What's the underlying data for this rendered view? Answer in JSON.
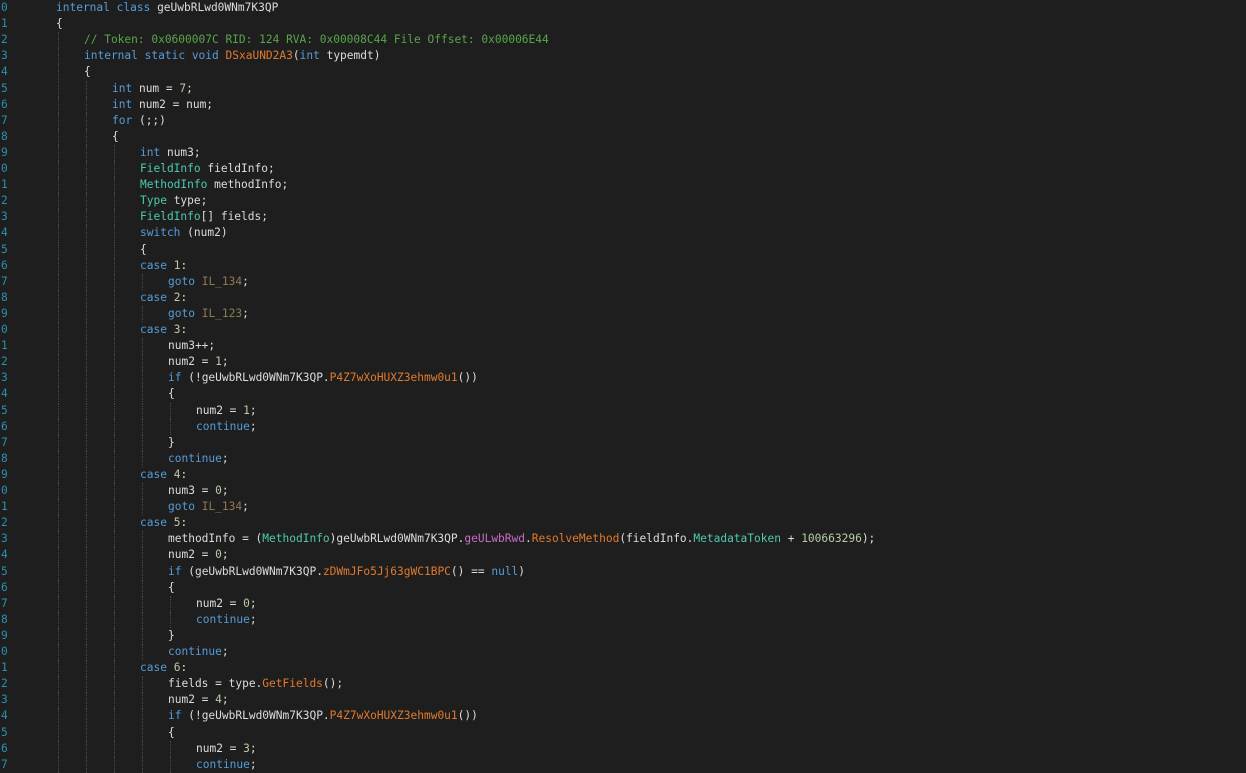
{
  "editor": {
    "theme_colors": {
      "background": "#1e1e1e",
      "line_number": "#2b91af",
      "keyword": "#569cd6",
      "type": "#4ec9b0",
      "comment": "#57a64a",
      "label": "#8c7b51",
      "method": "#e07a2e",
      "field": "#c76ac4",
      "number": "#b5cea8",
      "text": "#dcdcdc"
    },
    "lines": [
      {
        "n": "0",
        "d": 0,
        "t": [
          [
            "kw",
            "internal"
          ],
          [
            "p",
            " "
          ],
          [
            "kw",
            "class"
          ],
          [
            "p",
            " geUwbRLwd0WNm7K3QP"
          ]
        ]
      },
      {
        "n": "1",
        "d": 0,
        "t": [
          [
            "p",
            "{"
          ]
        ]
      },
      {
        "n": "2",
        "d": 1,
        "t": [
          [
            "cm",
            "// Token: 0x0600007C RID: 124 RVA: 0x00008C44 File Offset: 0x00006E44"
          ]
        ]
      },
      {
        "n": "3",
        "d": 1,
        "t": [
          [
            "kw",
            "internal"
          ],
          [
            "p",
            " "
          ],
          [
            "kw",
            "static"
          ],
          [
            "p",
            " "
          ],
          [
            "kw",
            "void"
          ],
          [
            "p",
            " "
          ],
          [
            "mth",
            "DSxaUND2A3"
          ],
          [
            "p",
            "("
          ],
          [
            "kw",
            "int"
          ],
          [
            "p",
            " typemdt)"
          ]
        ]
      },
      {
        "n": "4",
        "d": 1,
        "t": [
          [
            "p",
            "{"
          ]
        ]
      },
      {
        "n": "5",
        "d": 2,
        "t": [
          [
            "kw",
            "int"
          ],
          [
            "p",
            " num = "
          ],
          [
            "nm",
            "7"
          ],
          [
            "p",
            ";"
          ]
        ]
      },
      {
        "n": "6",
        "d": 2,
        "t": [
          [
            "kw",
            "int"
          ],
          [
            "p",
            " num2 = num;"
          ]
        ]
      },
      {
        "n": "7",
        "d": 2,
        "t": [
          [
            "kw",
            "for"
          ],
          [
            "p",
            " (;;)"
          ]
        ]
      },
      {
        "n": "8",
        "d": 2,
        "t": [
          [
            "p",
            "{"
          ]
        ]
      },
      {
        "n": "9",
        "d": 3,
        "t": [
          [
            "kw",
            "int"
          ],
          [
            "p",
            " num3;"
          ]
        ]
      },
      {
        "n": "0",
        "d": 3,
        "t": [
          [
            "ty",
            "FieldInfo"
          ],
          [
            "p",
            " fieldInfo;"
          ]
        ]
      },
      {
        "n": "1",
        "d": 3,
        "t": [
          [
            "ty",
            "MethodInfo"
          ],
          [
            "p",
            " methodInfo;"
          ]
        ]
      },
      {
        "n": "2",
        "d": 3,
        "t": [
          [
            "ty",
            "Type"
          ],
          [
            "p",
            " type;"
          ]
        ]
      },
      {
        "n": "3",
        "d": 3,
        "t": [
          [
            "ty",
            "FieldInfo"
          ],
          [
            "p",
            "[] fields;"
          ]
        ]
      },
      {
        "n": "4",
        "d": 3,
        "t": [
          [
            "kw",
            "switch"
          ],
          [
            "p",
            " (num2)"
          ]
        ]
      },
      {
        "n": "5",
        "d": 3,
        "t": [
          [
            "p",
            "{"
          ]
        ]
      },
      {
        "n": "6",
        "d": 3,
        "t": [
          [
            "kw",
            "case"
          ],
          [
            "p",
            " "
          ],
          [
            "nm",
            "1"
          ],
          [
            "p",
            ":"
          ]
        ]
      },
      {
        "n": "7",
        "d": 4,
        "t": [
          [
            "kw",
            "goto"
          ],
          [
            "p",
            " "
          ],
          [
            "lbl",
            "IL_134"
          ],
          [
            "p",
            ";"
          ]
        ]
      },
      {
        "n": "8",
        "d": 3,
        "t": [
          [
            "kw",
            "case"
          ],
          [
            "p",
            " "
          ],
          [
            "nm",
            "2"
          ],
          [
            "p",
            ":"
          ]
        ]
      },
      {
        "n": "9",
        "d": 4,
        "t": [
          [
            "kw",
            "goto"
          ],
          [
            "p",
            " "
          ],
          [
            "lbl",
            "IL_123"
          ],
          [
            "p",
            ";"
          ]
        ]
      },
      {
        "n": "0",
        "d": 3,
        "t": [
          [
            "kw",
            "case"
          ],
          [
            "p",
            " "
          ],
          [
            "nm",
            "3"
          ],
          [
            "p",
            ":"
          ]
        ]
      },
      {
        "n": "1",
        "d": 4,
        "t": [
          [
            "p",
            "num3++;"
          ]
        ]
      },
      {
        "n": "2",
        "d": 4,
        "t": [
          [
            "p",
            "num2 = "
          ],
          [
            "nm",
            "1"
          ],
          [
            "p",
            ";"
          ]
        ]
      },
      {
        "n": "3",
        "d": 4,
        "t": [
          [
            "kw",
            "if"
          ],
          [
            "p",
            " (!geUwbRLwd0WNm7K3QP."
          ],
          [
            "mth",
            "P4Z7wXoHUXZ3ehmw0u1"
          ],
          [
            "p",
            "())"
          ]
        ]
      },
      {
        "n": "4",
        "d": 4,
        "t": [
          [
            "p",
            "{"
          ]
        ]
      },
      {
        "n": "5",
        "d": 5,
        "t": [
          [
            "p",
            "num2 = "
          ],
          [
            "nm",
            "1"
          ],
          [
            "p",
            ";"
          ]
        ]
      },
      {
        "n": "6",
        "d": 5,
        "t": [
          [
            "kw",
            "continue"
          ],
          [
            "p",
            ";"
          ]
        ]
      },
      {
        "n": "7",
        "d": 4,
        "t": [
          [
            "p",
            "}"
          ]
        ]
      },
      {
        "n": "8",
        "d": 4,
        "t": [
          [
            "kw",
            "continue"
          ],
          [
            "p",
            ";"
          ]
        ]
      },
      {
        "n": "9",
        "d": 3,
        "t": [
          [
            "kw",
            "case"
          ],
          [
            "p",
            " "
          ],
          [
            "nm",
            "4"
          ],
          [
            "p",
            ":"
          ]
        ]
      },
      {
        "n": "0",
        "d": 4,
        "t": [
          [
            "p",
            "num3 = "
          ],
          [
            "nm",
            "0"
          ],
          [
            "p",
            ";"
          ]
        ]
      },
      {
        "n": "1",
        "d": 4,
        "t": [
          [
            "kw",
            "goto"
          ],
          [
            "p",
            " "
          ],
          [
            "lbl",
            "IL_134"
          ],
          [
            "p",
            ";"
          ]
        ]
      },
      {
        "n": "2",
        "d": 3,
        "t": [
          [
            "kw",
            "case"
          ],
          [
            "p",
            " "
          ],
          [
            "nm",
            "5"
          ],
          [
            "p",
            ":"
          ]
        ]
      },
      {
        "n": "3",
        "d": 4,
        "t": [
          [
            "p",
            "methodInfo = ("
          ],
          [
            "ty",
            "MethodInfo"
          ],
          [
            "p",
            ")geUwbRLwd0WNm7K3QP."
          ],
          [
            "fld",
            "geULwbRwd"
          ],
          [
            "p",
            "."
          ],
          [
            "mth",
            "ResolveMethod"
          ],
          [
            "p",
            "(fieldInfo."
          ],
          [
            "prp",
            "MetadataToken"
          ],
          [
            "p",
            " + "
          ],
          [
            "nm",
            "100663296"
          ],
          [
            "p",
            ");"
          ]
        ]
      },
      {
        "n": "4",
        "d": 4,
        "t": [
          [
            "p",
            "num2 = "
          ],
          [
            "nm",
            "0"
          ],
          [
            "p",
            ";"
          ]
        ]
      },
      {
        "n": "5",
        "d": 4,
        "t": [
          [
            "kw",
            "if"
          ],
          [
            "p",
            " (geUwbRLwd0WNm7K3QP."
          ],
          [
            "mth",
            "zDWmJFo5Jj63gWC1BPC"
          ],
          [
            "p",
            "() == "
          ],
          [
            "kw",
            "null"
          ],
          [
            "p",
            ")"
          ]
        ]
      },
      {
        "n": "6",
        "d": 4,
        "t": [
          [
            "p",
            "{"
          ]
        ]
      },
      {
        "n": "7",
        "d": 5,
        "t": [
          [
            "p",
            "num2 = "
          ],
          [
            "nm",
            "0"
          ],
          [
            "p",
            ";"
          ]
        ]
      },
      {
        "n": "8",
        "d": 5,
        "t": [
          [
            "kw",
            "continue"
          ],
          [
            "p",
            ";"
          ]
        ]
      },
      {
        "n": "9",
        "d": 4,
        "t": [
          [
            "p",
            "}"
          ]
        ]
      },
      {
        "n": "0",
        "d": 4,
        "t": [
          [
            "kw",
            "continue"
          ],
          [
            "p",
            ";"
          ]
        ]
      },
      {
        "n": "1",
        "d": 3,
        "t": [
          [
            "kw",
            "case"
          ],
          [
            "p",
            " "
          ],
          [
            "nm",
            "6"
          ],
          [
            "p",
            ":"
          ]
        ]
      },
      {
        "n": "2",
        "d": 4,
        "t": [
          [
            "p",
            "fields = type."
          ],
          [
            "mth",
            "GetFields"
          ],
          [
            "p",
            "();"
          ]
        ]
      },
      {
        "n": "3",
        "d": 4,
        "t": [
          [
            "p",
            "num2 = "
          ],
          [
            "nm",
            "4"
          ],
          [
            "p",
            ";"
          ]
        ]
      },
      {
        "n": "4",
        "d": 4,
        "t": [
          [
            "kw",
            "if"
          ],
          [
            "p",
            " (!geUwbRLwd0WNm7K3QP."
          ],
          [
            "mth",
            "P4Z7wXoHUXZ3ehmw0u1"
          ],
          [
            "p",
            "())"
          ]
        ]
      },
      {
        "n": "5",
        "d": 4,
        "t": [
          [
            "p",
            "{"
          ]
        ]
      },
      {
        "n": "6",
        "d": 5,
        "t": [
          [
            "p",
            "num2 = "
          ],
          [
            "nm",
            "3"
          ],
          [
            "p",
            ";"
          ]
        ]
      },
      {
        "n": "7",
        "d": 5,
        "t": [
          [
            "kw",
            "continue"
          ],
          [
            "p",
            ";"
          ]
        ]
      }
    ]
  }
}
